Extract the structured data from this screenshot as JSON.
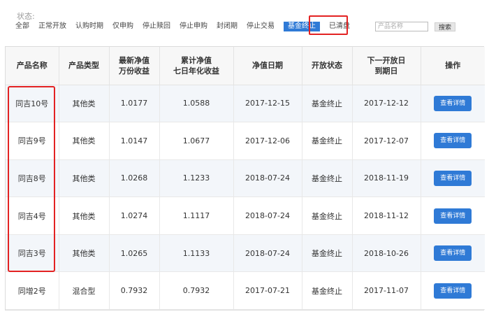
{
  "filters": {
    "status_label": "状态:",
    "items": [
      "全部",
      "正常开放",
      "认购时期",
      "仅申购",
      "停止赎回",
      "停止申购",
      "封闭期",
      "停止交易",
      "基金终止",
      "已清盘"
    ],
    "active_index": 8,
    "search_placeholder": "产品名称",
    "search_button": "搜索"
  },
  "table": {
    "headers": [
      [
        "产品名称"
      ],
      [
        "产品类型"
      ],
      [
        "最新净值",
        "万份收益"
      ],
      [
        "累计净值",
        "七日年化收益"
      ],
      [
        "净值日期"
      ],
      [
        "开放状态"
      ],
      [
        "下一开放日",
        "到期日"
      ],
      [
        "操作"
      ]
    ],
    "rows": [
      {
        "name": "同吉10号",
        "type": "其他类",
        "nav": "1.0177",
        "cum_nav": "1.0588",
        "date": "2017-12-15",
        "status": "基金终止",
        "next_date": "2017-12-12",
        "action": "查看详情"
      },
      {
        "name": "同吉9号",
        "type": "其他类",
        "nav": "1.0147",
        "cum_nav": "1.0677",
        "date": "2017-12-06",
        "status": "基金终止",
        "next_date": "2017-12-07",
        "action": "查看详情"
      },
      {
        "name": "同吉8号",
        "type": "其他类",
        "nav": "1.0268",
        "cum_nav": "1.1233",
        "date": "2018-07-24",
        "status": "基金终止",
        "next_date": "2018-11-19",
        "action": "查看详情"
      },
      {
        "name": "同吉4号",
        "type": "其他类",
        "nav": "1.0274",
        "cum_nav": "1.1117",
        "date": "2018-07-24",
        "status": "基金终止",
        "next_date": "2018-11-12",
        "action": "查看详情"
      },
      {
        "name": "同吉3号",
        "type": "其他类",
        "nav": "1.0265",
        "cum_nav": "1.1133",
        "date": "2018-07-24",
        "status": "基金终止",
        "next_date": "2018-10-26",
        "action": "查看详情"
      },
      {
        "name": "同增2号",
        "type": "混合型",
        "nav": "0.7932",
        "cum_nav": "0.7932",
        "date": "2017-07-21",
        "status": "基金终止",
        "next_date": "2017-11-07",
        "action": "查看详情"
      }
    ]
  },
  "colors": {
    "accent": "#2f7ad6",
    "highlight_border": "#e32222",
    "row_alt": "#f3f6fa"
  }
}
